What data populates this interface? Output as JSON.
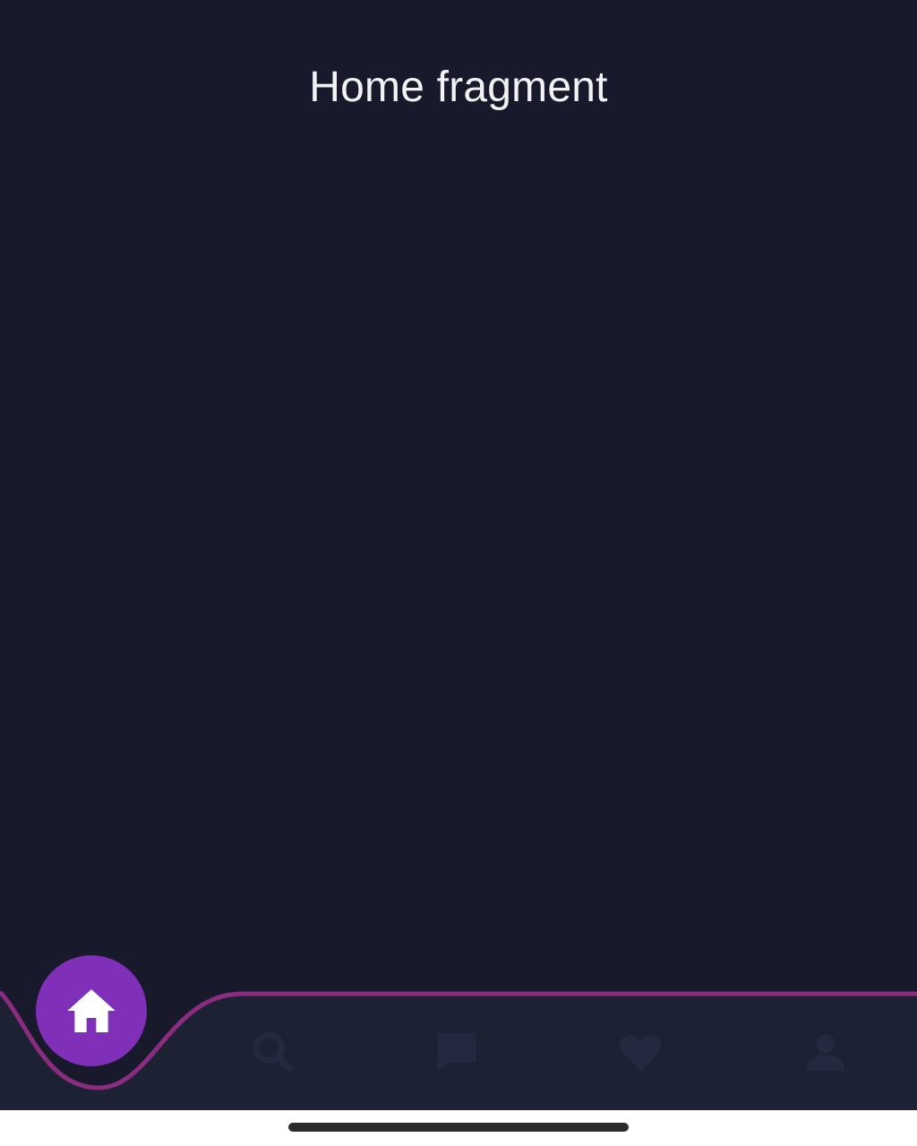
{
  "screen": {
    "title": "Home fragment"
  },
  "bottom_nav": {
    "active_item": "home",
    "items": [
      {
        "id": "home",
        "icon": "home-icon",
        "active": true
      },
      {
        "id": "search",
        "icon": "search-icon",
        "active": false
      },
      {
        "id": "chat",
        "icon": "chat-icon",
        "active": false
      },
      {
        "id": "favorites",
        "icon": "heart-icon",
        "active": false
      },
      {
        "id": "profile",
        "icon": "person-icon",
        "active": false
      }
    ]
  },
  "colors": {
    "background": "#181a2b",
    "nav_bar": "#1c2233",
    "nav_outline": "#8a2c7f",
    "accent": "#7f2fb8",
    "inactive_icon": "#232a40",
    "title_text": "#f2f2f4",
    "system_bar": "#ffffff",
    "home_indicator": "#2b2b2b"
  }
}
